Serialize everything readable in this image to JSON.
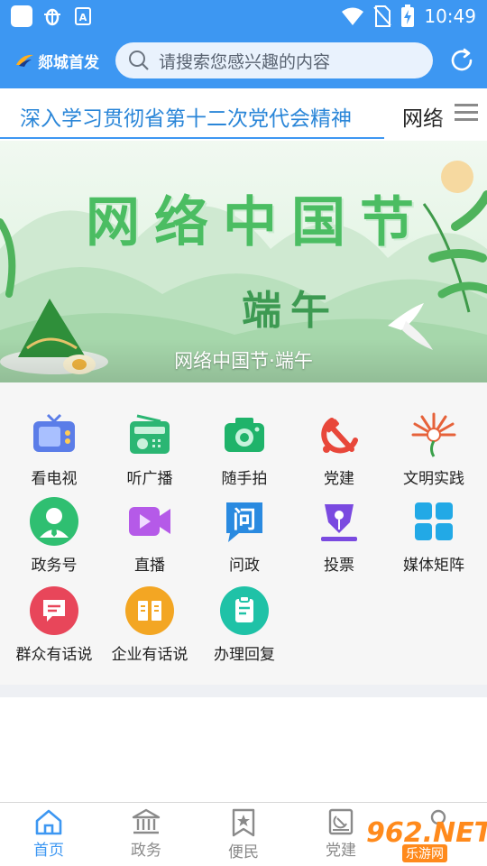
{
  "status_bar": {
    "time": "10:49"
  },
  "header": {
    "brand_name": "郯城首发",
    "search_placeholder": "请搜索您感兴趣的内容"
  },
  "ticker": {
    "items": [
      "深入学习贯彻省第十二次党代会精神",
      "网络"
    ]
  },
  "banner": {
    "title_art": "网络中国节",
    "subtitle_art": "端午",
    "caption": "网络中国节·端午"
  },
  "features": [
    {
      "label": "看电视",
      "icon": "tv-icon",
      "color": "#5b7de8"
    },
    {
      "label": "听广播",
      "icon": "radio-icon",
      "color": "#2bb673"
    },
    {
      "label": "随手拍",
      "icon": "camera-icon",
      "color": "#1fb36a"
    },
    {
      "label": "党建",
      "icon": "hammer-sickle-icon",
      "color": "#e8473a"
    },
    {
      "label": "文明实践",
      "icon": "fan-logo-icon",
      "color": "#e6623a"
    },
    {
      "label": "政务号",
      "icon": "official-person-icon",
      "color": "#2fbf71"
    },
    {
      "label": "直播",
      "icon": "video-camera-icon",
      "color": "#b55ae8"
    },
    {
      "label": "问政",
      "icon": "question-chat-icon",
      "color": "#2a8ae0"
    },
    {
      "label": "投票",
      "icon": "vote-pen-icon",
      "color": "#7a4ae0"
    },
    {
      "label": "媒体矩阵",
      "icon": "grid-matrix-icon",
      "color": "#22a9e6"
    },
    {
      "label": "群众有话说",
      "icon": "message-icon",
      "color": "#e8465a"
    },
    {
      "label": "企业有话说",
      "icon": "book-icon",
      "color": "#f3a623"
    },
    {
      "label": "办理回复",
      "icon": "clipboard-icon",
      "color": "#1fc2a7"
    }
  ],
  "tabs": [
    {
      "label": "首页",
      "icon": "home-icon",
      "active": true
    },
    {
      "label": "政务",
      "icon": "government-building-icon",
      "active": false
    },
    {
      "label": "便民",
      "icon": "star-bookmark-icon",
      "active": false
    },
    {
      "label": "党建",
      "icon": "party-book-icon",
      "active": false
    }
  ],
  "watermark": {
    "brand": "962.NET",
    "sub": "乐游网"
  },
  "colors": {
    "primary": "#3d97f2",
    "tab_active": "#3d97f2",
    "tab_inactive": "#8a8a8a"
  }
}
